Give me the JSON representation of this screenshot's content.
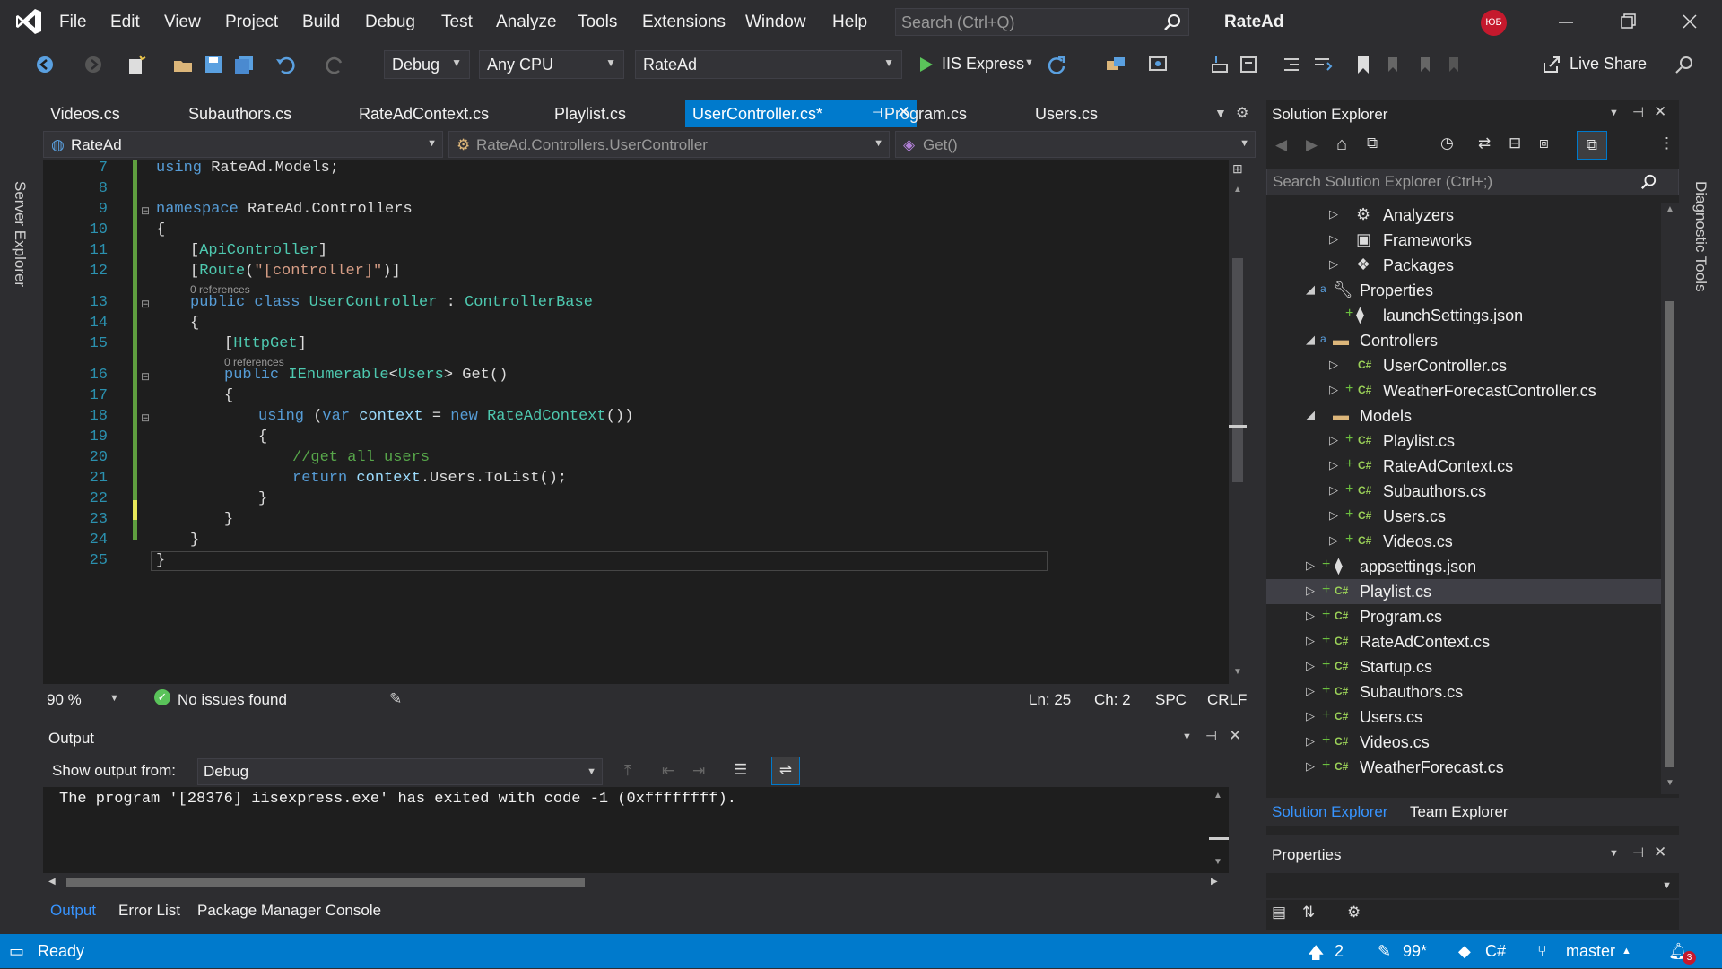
{
  "menu": [
    "File",
    "Edit",
    "View",
    "Project",
    "Build",
    "Debug",
    "Test",
    "Analyze",
    "Tools",
    "Extensions",
    "Window",
    "Help"
  ],
  "search": {
    "placeholder": "Search (Ctrl+Q)"
  },
  "solution_name": "RateAd",
  "user_initials": "ЮБ",
  "toolbar": {
    "config": "Debug",
    "platform": "Any CPU",
    "startup_project": "RateAd",
    "run_label": "IIS Express",
    "live_share": "Live Share"
  },
  "left_strip_label": "Server Explorer",
  "right_strip_label": "Diagnostic Tools",
  "doc_tabs": [
    "Videos.cs",
    "Subauthors.cs",
    "RateAdContext.cs",
    "Playlist.cs",
    "UserController.cs*",
    "Program.cs",
    "Users.cs"
  ],
  "nav_bar": {
    "project": "RateAd",
    "type": "RateAd.Controllers.UserController",
    "member": "Get()"
  },
  "code": {
    "line_numbers": [
      "7",
      "8",
      "9",
      "10",
      "11",
      "12",
      "13",
      "14",
      "15",
      "16",
      "17",
      "18",
      "19",
      "20",
      "21",
      "22",
      "23",
      "24",
      "25"
    ],
    "refs_label": "0 references",
    "l7a": "using",
    "l7b": " RateAd.Models;",
    "l9a": "namespace",
    "l9b": " RateAd.Controllers",
    "l10": "{",
    "l11a": "[",
    "l11b": "ApiController",
    "l11c": "]",
    "l12a": "[",
    "l12b": "Route",
    "l12c": "(",
    "l12d": "\"[controller]\"",
    "l12e": ")]",
    "l13a": "public",
    "l13b": " class",
    "l13c": " UserController",
    "l13d": " : ",
    "l13e": "ControllerBase",
    "l14": "{",
    "l15a": "[",
    "l15b": "HttpGet",
    "l15c": "]",
    "l16a": "public",
    "l16b": " IEnumerable",
    "l16c": "<",
    "l16d": "Users",
    "l16e": "> Get()",
    "l17": "{",
    "l18a": "using",
    "l18b": " (",
    "l18c": "var",
    "l18d": " context",
    "l18e": " = ",
    "l18f": "new",
    "l18g": " RateAdContext",
    "l18h": "())",
    "l19": "{",
    "l20": "//get all users",
    "l21a": "return",
    "l21b": " context",
    "l21c": ".Users.ToList();",
    "l22": "}",
    "l23": "}",
    "l24": "}",
    "l25": "}"
  },
  "editor_status": {
    "zoom": "90 %",
    "issues": "No issues found",
    "ln": "Ln: 25",
    "ch": "Ch: 2",
    "spc": "SPC",
    "crlf": "CRLF"
  },
  "output": {
    "title": "Output",
    "show_from_label": "Show output from:",
    "source": "Debug",
    "text": "The program '[28376] iisexpress.exe' has exited with code -1 (0xffffffff).",
    "tabs": [
      "Output",
      "Error List",
      "Package Manager Console"
    ]
  },
  "solution_explorer": {
    "title": "Solution Explorer",
    "search_placeholder": "Search Solution Explorer (Ctrl+;)",
    "items": [
      {
        "label": "Analyzers"
      },
      {
        "label": "Frameworks"
      },
      {
        "label": "Packages"
      },
      {
        "label": "Properties"
      },
      {
        "label": "launchSettings.json"
      },
      {
        "label": "Controllers"
      },
      {
        "label": "UserController.cs"
      },
      {
        "label": "WeatherForecastController.cs"
      },
      {
        "label": "Models"
      },
      {
        "label": "Playlist.cs"
      },
      {
        "label": "RateAdContext.cs"
      },
      {
        "label": "Subauthors.cs"
      },
      {
        "label": "Users.cs"
      },
      {
        "label": "Videos.cs"
      },
      {
        "label": "appsettings.json"
      },
      {
        "label": "Playlist.cs"
      },
      {
        "label": "Program.cs"
      },
      {
        "label": "RateAdContext.cs"
      },
      {
        "label": "Startup.cs"
      },
      {
        "label": "Subauthors.cs"
      },
      {
        "label": "Users.cs"
      },
      {
        "label": "Videos.cs"
      },
      {
        "label": "WeatherForecast.cs"
      }
    ],
    "bottom_tabs": [
      "Solution Explorer",
      "Team Explorer"
    ]
  },
  "properties_panel": {
    "title": "Properties"
  },
  "statusbar": {
    "ready": "Ready",
    "up_count": "2",
    "pending": "99*",
    "lang": "C#",
    "branch": "master",
    "notif_count": "3"
  },
  "csharp_badge": "C#"
}
